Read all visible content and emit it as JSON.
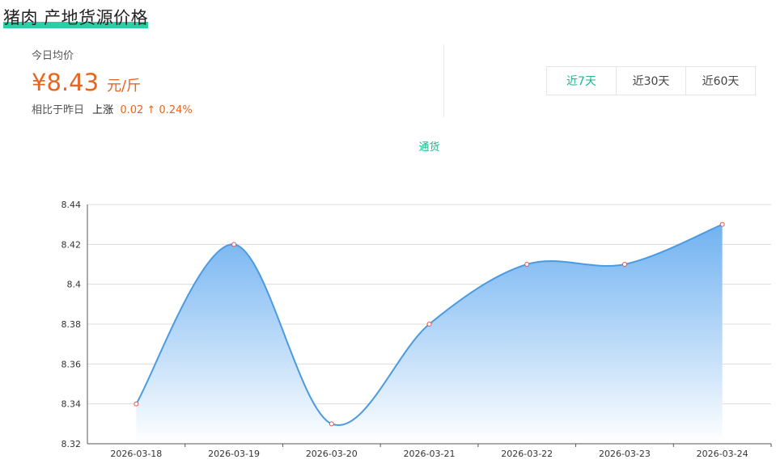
{
  "header": {
    "title": "猪肉 产地货源价格"
  },
  "stats": {
    "label": "今日均价",
    "price": "¥8.43",
    "unit": "元/斤",
    "compare_label": "相比于昨日",
    "direction": "上涨",
    "change": "0.02 ↑ 0.24%"
  },
  "range_tabs": [
    {
      "label": "近7天",
      "active": true
    },
    {
      "label": "近30天",
      "active": false
    },
    {
      "label": "近60天",
      "active": false
    }
  ],
  "colors": {
    "accent": "#2ccfa5",
    "price": "#e8651f",
    "series_line": "#4a9be0",
    "series_fill_top": "#6aaef0",
    "point_marker": "#e05050"
  },
  "chart_data": {
    "type": "area",
    "x": [
      "2026-03-18",
      "2026-03-19",
      "2026-03-20",
      "2026-03-21",
      "2026-03-22",
      "2026-03-23",
      "2026-03-24"
    ],
    "series": [
      {
        "name": "通货",
        "values": [
          8.34,
          8.42,
          8.33,
          8.38,
          8.41,
          8.41,
          8.43
        ]
      }
    ],
    "yticks": [
      "8.32",
      "8.34",
      "8.36",
      "8.38",
      "8.4",
      "8.42",
      "8.44"
    ],
    "ylim": [
      8.32,
      8.44
    ],
    "smooth": true,
    "grid": true,
    "legend": "top-center"
  }
}
